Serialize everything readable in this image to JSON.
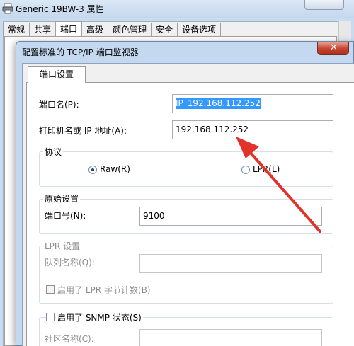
{
  "back_window": {
    "title": "Generic 19BW-3 属性",
    "tabs": [
      "常规",
      "共享",
      "端口",
      "高级",
      "颜色管理",
      "安全",
      "设备选项"
    ],
    "active_tab": "端口"
  },
  "dialog": {
    "title": "配置标准的 TCP/IP 端口监视器",
    "close_glyph": "✕",
    "tab": "端口设置",
    "port_name": {
      "label": "端口名(P):",
      "value": "IP_192.168.112.252"
    },
    "host": {
      "label": "打印机名或 IP 地址(A):",
      "value": "192.168.112.252"
    },
    "protocol": {
      "title": "协议",
      "raw": {
        "label": "Raw(R)",
        "selected": true
      },
      "lpr": {
        "label": "LPR(L)",
        "selected": false
      }
    },
    "raw_settings": {
      "title": "原始设置",
      "port_label": "端口号(N):",
      "port_value": "9100"
    },
    "lpr_settings": {
      "title": "LPR 设置",
      "queue_label": "队列名称(Q):",
      "queue_value": "",
      "byte_count_label": "启用了 LPR 字节计数(B)"
    },
    "snmp": {
      "label": "启用了 SNMP 状态(S)",
      "community_label": "社区名称(C):",
      "community_value": ""
    }
  },
  "colors": {
    "arrow": "#e2332b",
    "selection": "#3399ff",
    "close_button": "#c5412e"
  }
}
